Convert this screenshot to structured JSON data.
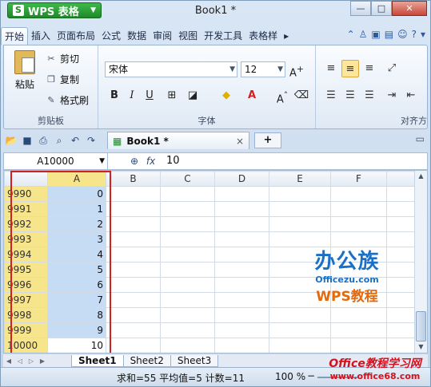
{
  "window": {
    "app_name": "WPS 表格",
    "doc_title": "Book1 *",
    "controls": {
      "minimize": "—",
      "maximize": "□",
      "close": "✕"
    }
  },
  "menu": {
    "tabs": [
      "开始",
      "插入",
      "页面布局",
      "公式",
      "数据",
      "审阅",
      "视图",
      "开发工具",
      "表格样"
    ],
    "active_tab": "开始"
  },
  "ribbon": {
    "clipboard": {
      "paste": "粘贴",
      "cut": "剪切",
      "copy": "复制",
      "format_painter": "格式刷",
      "group_label": "剪贴板"
    },
    "font": {
      "font_name": "宋体",
      "font_size": "12",
      "group_label": "字体"
    },
    "alignment": {
      "group_label": "对齐方"
    }
  },
  "tabbar": {
    "doc_tab": "Book1 *",
    "new_tab": "+"
  },
  "formula_bar": {
    "name_box": "A10000",
    "fx": "fx",
    "value": "10"
  },
  "sheet": {
    "columns": [
      "A",
      "B",
      "C",
      "D",
      "E",
      "F"
    ],
    "rows": [
      {
        "row": "9990",
        "a": "0"
      },
      {
        "row": "9991",
        "a": "1"
      },
      {
        "row": "9992",
        "a": "2"
      },
      {
        "row": "9993",
        "a": "3"
      },
      {
        "row": "9994",
        "a": "4"
      },
      {
        "row": "9995",
        "a": "5"
      },
      {
        "row": "9996",
        "a": "6"
      },
      {
        "row": "9997",
        "a": "7"
      },
      {
        "row": "9998",
        "a": "8"
      },
      {
        "row": "9999",
        "a": "9"
      },
      {
        "row": "10000",
        "a": "10"
      }
    ]
  },
  "sheets": [
    "Sheet1",
    "Sheet2",
    "Sheet3"
  ],
  "status": {
    "summary": "求和=55 平均值=5 计数=11",
    "zoom": "100 %"
  },
  "watermark": {
    "logo_main": "办公族",
    "logo_url": "Officezu.com",
    "logo_sub": "WPS教程",
    "site_name": "Office教程学习网",
    "site_url": "www.office68.com"
  }
}
